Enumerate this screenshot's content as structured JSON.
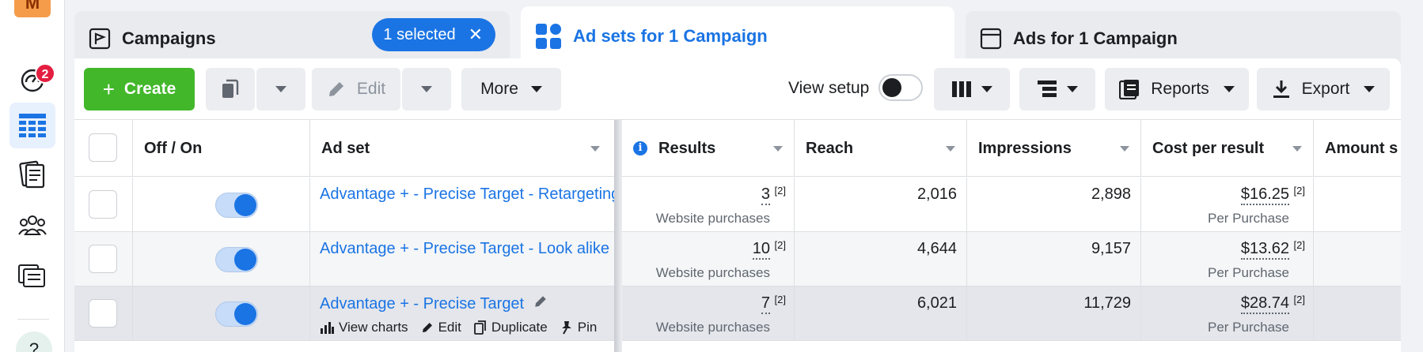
{
  "rail": {
    "avatar_letter": "M",
    "notification_count": "2",
    "help_label": "?"
  },
  "tabs": {
    "campaigns": {
      "label": "Campaigns",
      "selected_pill": "1 selected",
      "clear": "✕"
    },
    "adsets": {
      "label": "Ad sets for 1 Campaign"
    },
    "ads": {
      "label": "Ads for 1 Campaign"
    }
  },
  "toolbar": {
    "create": "Create",
    "create_icon": "+",
    "edit": "Edit",
    "more": "More",
    "view_setup": "View setup",
    "reports": "Reports",
    "export": "Export"
  },
  "table": {
    "headers": {
      "toggle": "Off / On",
      "adset": "Ad set",
      "results": "Results",
      "reach": "Reach",
      "impressions": "Impressions",
      "cost": "Cost per result",
      "amount": "Amount s"
    },
    "info_icon": "i",
    "footnote": "[2]",
    "rows": [
      {
        "name": "Advantage + - Precise Target - Retargeting",
        "results": "3",
        "results_type": "Website purchases",
        "reach": "2,016",
        "impressions": "2,898",
        "cost": "$16.25",
        "cost_type": "Per Purchase"
      },
      {
        "name": "Advantage + - Precise Target - Look alike",
        "results": "10",
        "results_type": "Website purchases",
        "reach": "4,644",
        "impressions": "9,157",
        "cost": "$13.62",
        "cost_type": "Per Purchase"
      },
      {
        "name": "Advantage + - Precise Target",
        "results": "7",
        "results_type": "Website purchases",
        "reach": "6,021",
        "impressions": "11,729",
        "cost": "$28.74",
        "cost_type": "Per Purchase"
      }
    ],
    "row_actions": {
      "view_charts": "View charts",
      "edit": "Edit",
      "duplicate": "Duplicate",
      "pin": "Pin"
    }
  },
  "colors": {
    "accent": "#1b74e4",
    "create": "#42b72a",
    "badge": "#e41e3f"
  }
}
